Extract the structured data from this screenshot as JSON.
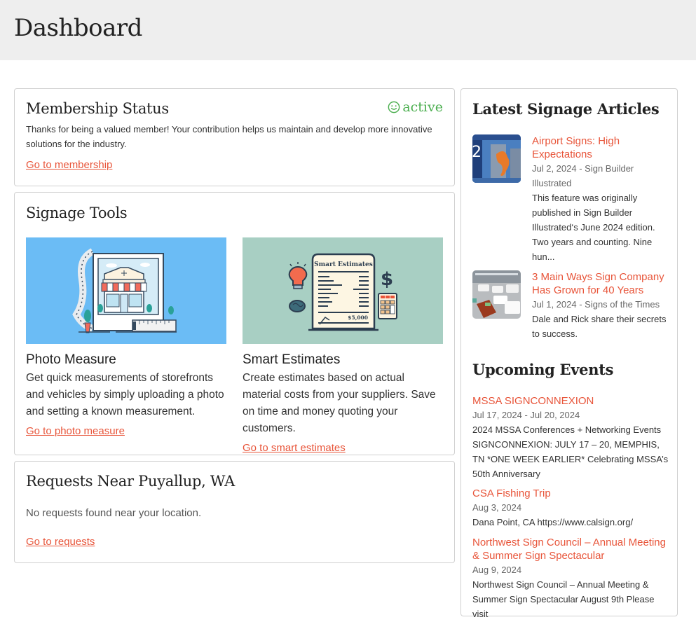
{
  "header": {
    "title": "Dashboard"
  },
  "membership": {
    "title": "Membership Status",
    "status_label": "active",
    "status_icon": "smile-icon",
    "status_color": "#4caf50",
    "description": "Thanks for being a valued member! Your contribution helps us maintain and develop more innovative solutions for the industry.",
    "link_label": "Go to membership"
  },
  "tools": {
    "title": "Signage Tools",
    "items": [
      {
        "title": "Photo Measure",
        "description": "Get quick measurements of storefronts and vehicles by simply uploading a photo and setting a known measurement.",
        "link_label": "Go to photo measure",
        "image": "storefront-photo-with-measuring-tape-illustration"
      },
      {
        "title": "Smart Estimates",
        "description": "Create estimates based on actual material costs from your suppliers. Save on time and money quoting your customers.",
        "link_label": "Go to smart estimates",
        "image": "estimate-document-illustration",
        "image_heading": "Smart Estimates",
        "image_total": "$5,000"
      }
    ]
  },
  "requests": {
    "title": "Requests Near Puyallup, WA",
    "empty_message": "No requests found near your location.",
    "link_label": "Go to requests"
  },
  "articles": {
    "title": "Latest Signage Articles",
    "items": [
      {
        "title": "Airport Signs: High Expectations",
        "meta": "Jul 2, 2024 - Sign Builder Illustrated",
        "excerpt": "This feature was originally published in Sign Builder Illustrated‘s June 2024 edition. Two years and counting. Nine hun...",
        "thumbnail": "airport-elevator-photo"
      },
      {
        "title": "3 Main Ways Sign Company Has Grown for 40 Years",
        "meta": "Jul 1, 2024 - Signs of the Times",
        "excerpt": "Dale and Rick share their secrets to success.",
        "thumbnail": "sign-shop-vehicles-photo"
      }
    ]
  },
  "events": {
    "title": "Upcoming Events",
    "items": [
      {
        "title": "MSSA SIGNCONNEXION",
        "date": "Jul 17, 2024 - Jul 20, 2024",
        "description": "2024 MSSA Conferences + Networking Events SIGNCONNEXION: JULY 17 – 20, MEMPHIS, TN *ONE WEEK EARLIER* Celebrating MSSA’s 50th Anniversary"
      },
      {
        "title": "CSA Fishing Trip",
        "date": "Aug 3, 2024",
        "description": "Dana Point, CA https://www.calsign.org/"
      },
      {
        "title": "Northwest Sign Council – Annual Meeting & Summer Sign Spectacular",
        "date": "Aug 9, 2024",
        "description": "Northwest Sign Council – Annual Meeting & Summer Sign Spectacular August 9th Please visit"
      }
    ]
  },
  "colors": {
    "accent": "#e8553a",
    "success": "#4caf50",
    "header_bg": "#eeeeee",
    "card_border": "#d0d0d0"
  }
}
